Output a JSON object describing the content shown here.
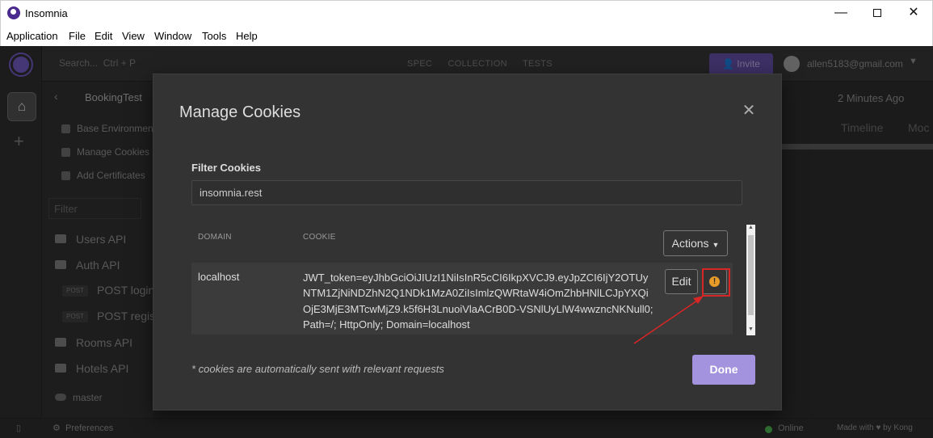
{
  "window": {
    "title": "Insomnia",
    "minimize": "—",
    "close": "✕"
  },
  "menu": [
    "Application",
    "File",
    "Edit",
    "View",
    "Window",
    "Tools",
    "Help"
  ],
  "topbar": {
    "search_placeholder": "Search...",
    "search_shortcut": "Ctrl + P",
    "tabs": [
      "SPEC",
      "COLLECTION",
      "TESTS"
    ],
    "invite_label": "Invite",
    "user_email": "allen5183@gmail.com"
  },
  "workspace": {
    "name": "BookingTest",
    "items": [
      "Base Environment",
      "Manage Cookies",
      "Add Certificates"
    ],
    "filter_placeholder": "Filter",
    "folders": [
      "Users API",
      "Auth API",
      "Rooms API",
      "Hotels API"
    ],
    "requests": [
      {
        "method": "POST",
        "label": "POST login"
      },
      {
        "method": "POST",
        "label": "POST regist"
      }
    ],
    "branch": "master"
  },
  "right_panel": {
    "timestamp": "2 Minutes Ago",
    "tabs": [
      "Timeline",
      "Moc"
    ]
  },
  "footer": {
    "preferences": "Preferences",
    "status": "Online",
    "made_with": "Made with ♥ by Kong"
  },
  "modal": {
    "title": "Manage Cookies",
    "filter_label": "Filter Cookies",
    "filter_value": "insomnia.rest",
    "columns": [
      "DOMAIN",
      "COOKIE"
    ],
    "actions_label": "Actions",
    "cookies": [
      {
        "domain": "localhost",
        "cookie": "JWT_token=eyJhbGciOiJIUzI1NiIsInR5cCI6IkpXVCJ9.eyJpZCI6IjY2OTUyNTM1ZjNiNDZhN2Q1NDk1MzA0ZiIsImlzQWRtaW4iOmZhbHNlLCJpYXQiOjE3MjE3MTcwMjZ9.k5f6H3LnuoiVlaACrB0D-VSNlUyLlW4wwzncNKNull0; Path=/; HttpOnly; Domain=localhost",
        "edit_label": "Edit"
      }
    ],
    "footnote": "* cookies are automatically sent with relevant requests",
    "done_label": "Done"
  },
  "colors": {
    "accent": "#a393de",
    "warning_icon": "#e89b29",
    "annotation": "#d82525"
  }
}
